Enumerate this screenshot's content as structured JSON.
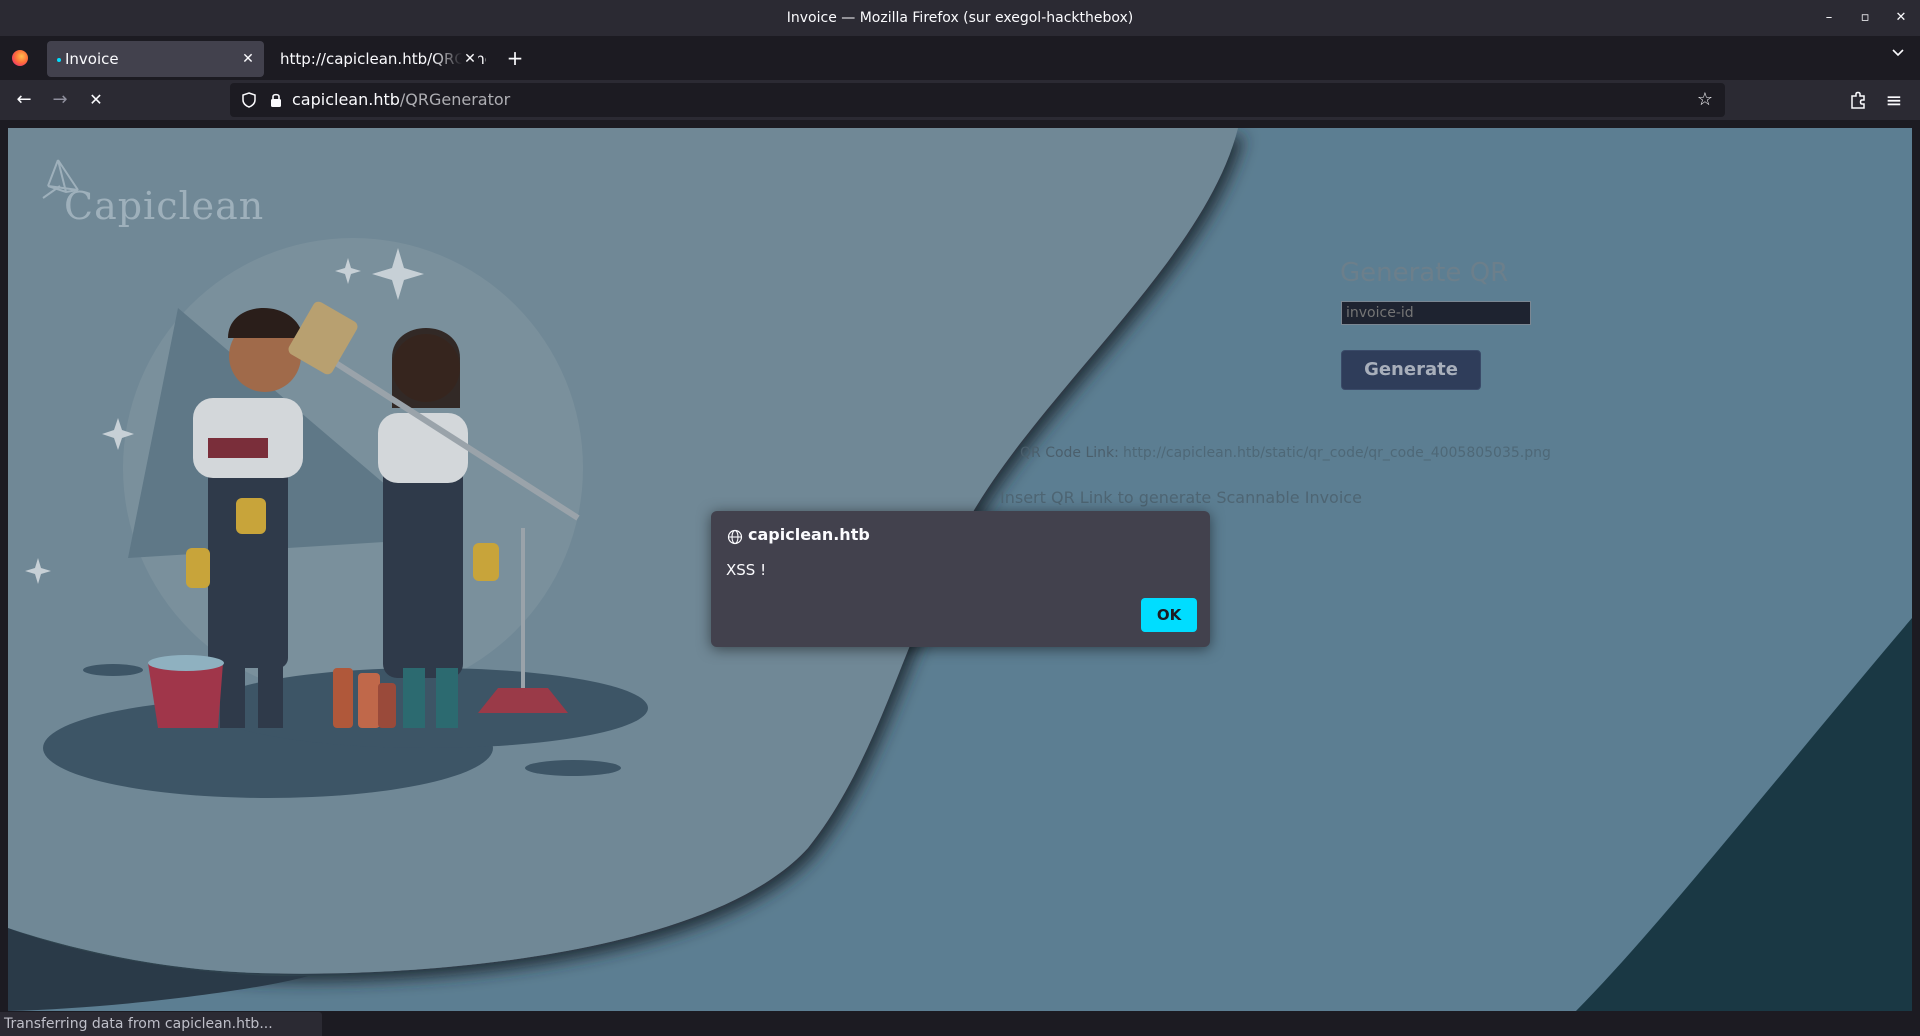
{
  "window": {
    "title": "Invoice — Mozilla Firefox (sur exegol-hackthebox)",
    "minimize_glyph": "–",
    "maximize_glyph": "▫",
    "close_glyph": "✕"
  },
  "tabs": [
    {
      "label": "Invoice",
      "active": true
    },
    {
      "label": "http://capiclean.htb/QRGenerator",
      "active": false
    }
  ],
  "toolbar": {
    "new_tab_glyph": "+",
    "tab_list_glyph": "⌄",
    "back_glyph": "←",
    "forward_glyph": "→",
    "stop_glyph": "✕",
    "star_glyph": "☆",
    "menu_glyph": "≡"
  },
  "urlbar": {
    "host": "capiclean.htb",
    "path": "/QRGenerator"
  },
  "page": {
    "logo_text": "Capiclean",
    "generate_title": "Generate QR",
    "input_placeholder": "invoice-id",
    "generate_button": "Generate",
    "qr_label": "QR Code Link:",
    "qr_link": "http://capiclean.htb/static/qr_code/qr_code_4005805035.png",
    "insert_text": "Insert QR Link to generate Scannable Invoice"
  },
  "dialog": {
    "origin": "capiclean.htb",
    "message": "XSS !",
    "ok_label": "OK"
  },
  "status": {
    "text": "Transferring data from capiclean.htb..."
  },
  "colors": {
    "accent": "#00ddff",
    "page_background": "#5c7e92",
    "wave_light": "#6f8896",
    "dark_corner": "#1a3844"
  }
}
